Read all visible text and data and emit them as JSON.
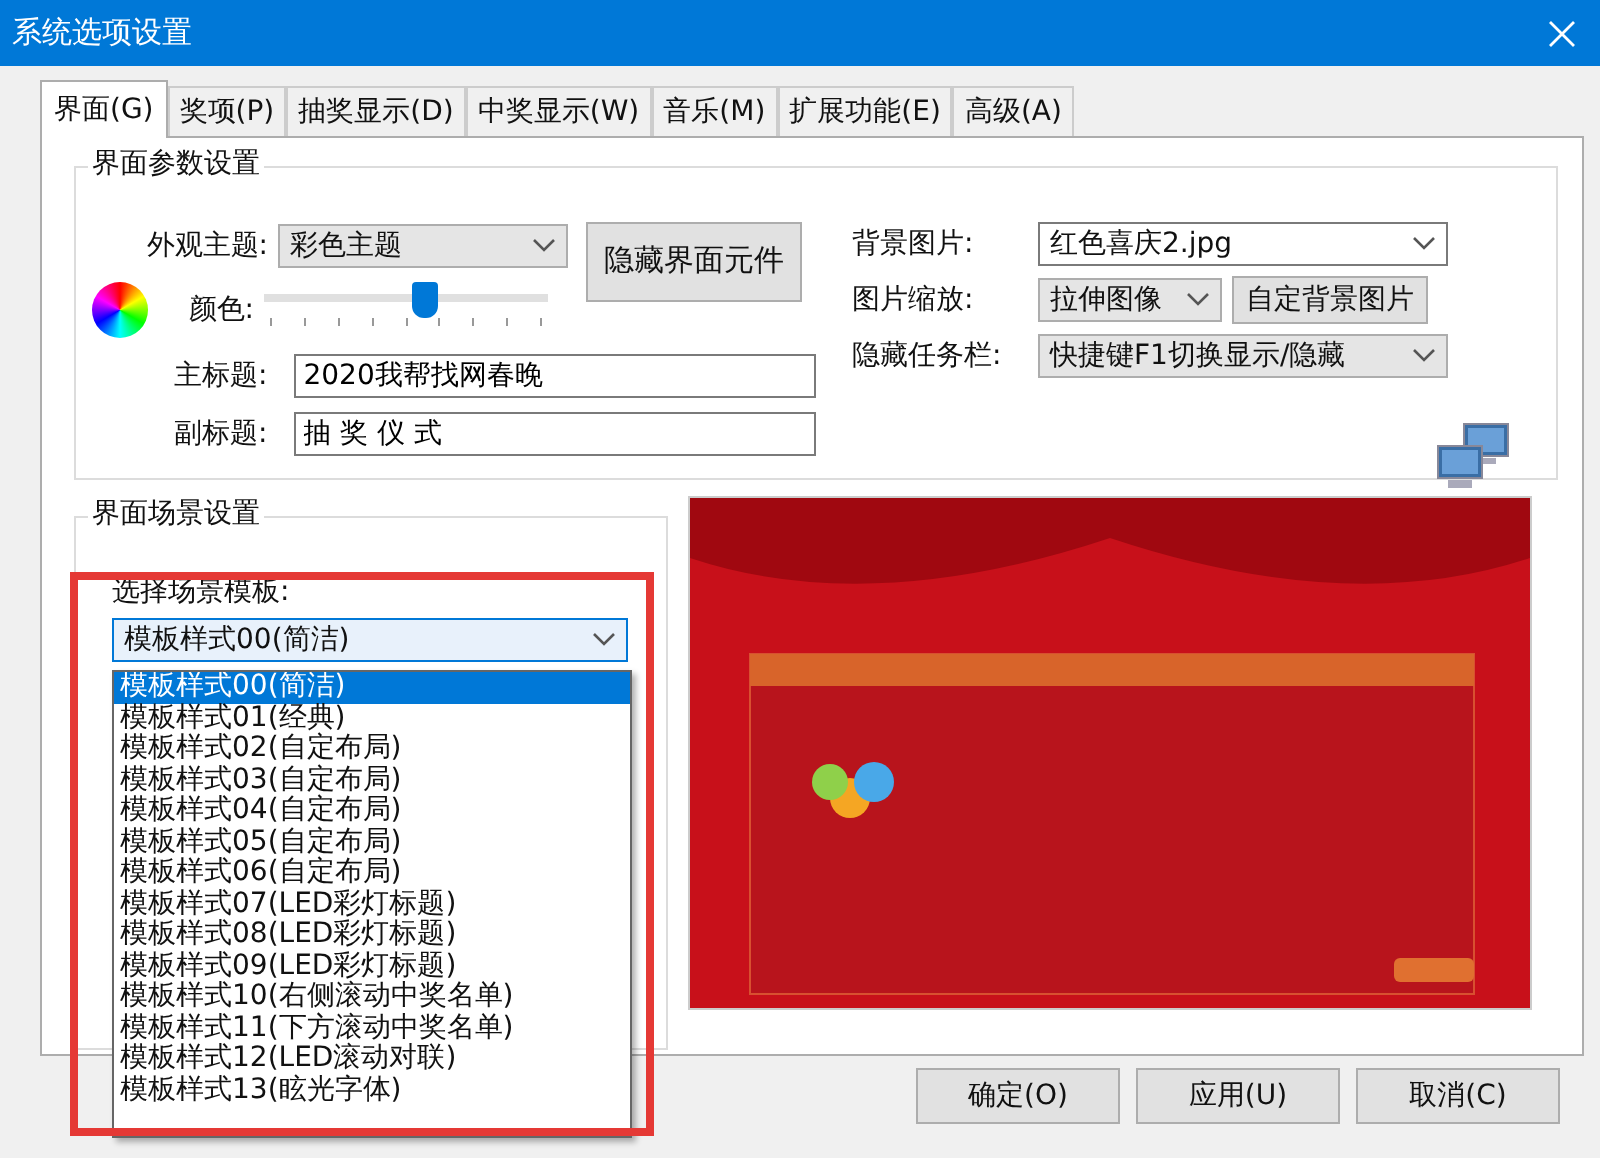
{
  "window": {
    "title": "系统选项设置"
  },
  "tabs": [
    {
      "label": "界面(G)",
      "selected": true
    },
    {
      "label": "奖项(P)",
      "selected": false
    },
    {
      "label": "抽奖显示(D)",
      "selected": false
    },
    {
      "label": "中奖显示(W)",
      "selected": false
    },
    {
      "label": "音乐(M)",
      "selected": false
    },
    {
      "label": "扩展功能(E)",
      "selected": false
    },
    {
      "label": "高级(A)",
      "selected": false
    }
  ],
  "params_group": {
    "title": "界面参数设置",
    "theme": {
      "label": "外观主题:",
      "value": "彩色主题"
    },
    "hide_button": "隐藏界面元件",
    "color": {
      "label": "颜色:",
      "level": 0.57
    },
    "main_title": {
      "label": "主标题:",
      "value": "2020我帮找网春晚"
    },
    "subtitle": {
      "label": "副标题:",
      "value": "抽 奖 仪 式"
    },
    "background": {
      "label": "背景图片:",
      "value": "红色喜庆2.jpg"
    },
    "scaling": {
      "label": "图片缩放:",
      "value": "拉伸图像"
    },
    "custom_bg_button": "自定背景图片",
    "hide_taskbar": {
      "label": "隐藏任务栏:",
      "value": "快捷键F1切换显示/隐藏"
    }
  },
  "scene_group": {
    "title": "界面场景设置",
    "template_label": "选择场景模板:",
    "template": {
      "value": "模板样式00(简洁)",
      "expanded": true
    },
    "options": [
      {
        "label": "模板样式00(简洁)",
        "selected": true
      },
      {
        "label": "模板样式01(经典)",
        "selected": false
      },
      {
        "label": "模板样式02(自定布局)",
        "selected": false
      },
      {
        "label": "模板样式03(自定布局)",
        "selected": false
      },
      {
        "label": "模板样式04(自定布局)",
        "selected": false
      },
      {
        "label": "模板样式05(自定布局)",
        "selected": false
      },
      {
        "label": "模板样式06(自定布局)",
        "selected": false
      },
      {
        "label": "模板样式07(LED彩灯标题)",
        "selected": false
      },
      {
        "label": "模板样式08(LED彩灯标题)",
        "selected": false
      },
      {
        "label": "模板样式09(LED彩灯标题)",
        "selected": false
      },
      {
        "label": "模板样式10(右侧滚动中奖名单)",
        "selected": false
      },
      {
        "label": "模板样式11(下方滚动中奖名单)",
        "selected": false
      },
      {
        "label": "模板样式12(LED滚动对联)",
        "selected": false
      },
      {
        "label": "模板样式13(眩光字体)",
        "selected": false
      }
    ]
  },
  "buttons": [
    "确定(O)",
    "应用(U)",
    "取消(C)"
  ]
}
